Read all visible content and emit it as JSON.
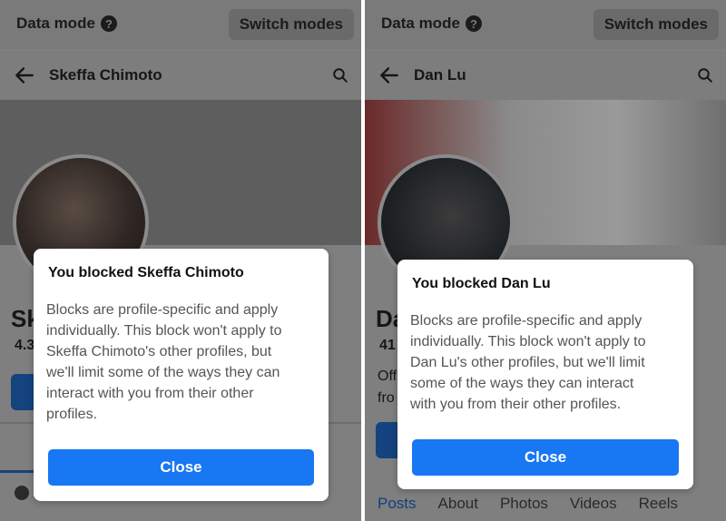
{
  "colors": {
    "accent": "#1877f2",
    "overlay": "#7f7f7f"
  },
  "left": {
    "data_mode": "Data mode",
    "switch_modes": "Switch modes",
    "profile_name": "Skeffa Chimoto",
    "partial_initial": "Sk",
    "partial_stat": "4.3",
    "dialog": {
      "title": "You blocked Skeffa Chimoto",
      "body_lines": [
        "Blocks are profile-specific and apply",
        "individually. This block won't apply to",
        "Skeffa Chimoto's other profiles, but",
        "we'll limit some of the ways they can",
        "interact with you from their other",
        "profiles."
      ],
      "close": "Close"
    }
  },
  "right": {
    "data_mode": "Data mode",
    "switch_modes": "Switch modes",
    "profile_name": "Dan Lu",
    "partial_initial": "Da",
    "partial_stat": "41",
    "partial_line1": "Off",
    "partial_line2": "fro",
    "dialog": {
      "title": "You blocked Dan Lu",
      "body_lines": [
        "Blocks are profile-specific and apply",
        "individually. This block won't apply to",
        "Dan Lu's other profiles, but we'll limit",
        "some of the ways they can interact",
        "with you from their other profiles."
      ],
      "close": "Close"
    },
    "tabs": [
      "Posts",
      "About",
      "Photos",
      "Videos",
      "Reels"
    ]
  }
}
